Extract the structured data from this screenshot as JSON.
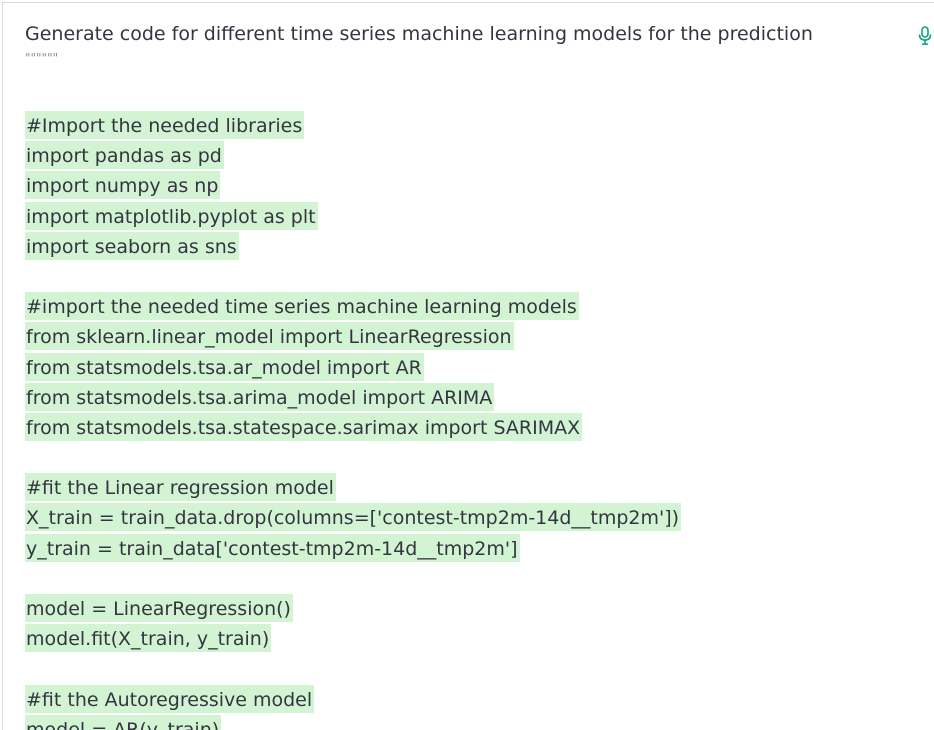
{
  "prompt": {
    "text": "Generate code for different time series machine learning models for the prediction",
    "quotes": "\"\"\"\"\"\""
  },
  "icons": {
    "mic": "microphone-icon",
    "accent": "#10a37f"
  },
  "colors": {
    "highlight": "#d2f4d3",
    "text": "#343541"
  },
  "code_lines": [
    "#Import the needed libraries",
    "import pandas as pd",
    "import numpy as np",
    "import matplotlib.pyplot as plt",
    "import seaborn as sns",
    "",
    "#import the needed time series machine learning models",
    "from sklearn.linear_model import LinearRegression",
    "from statsmodels.tsa.ar_model import AR",
    "from statsmodels.tsa.arima_model import ARIMA",
    "from statsmodels.tsa.statespace.sarimax import SARIMAX",
    "",
    "#fit the Linear regression model",
    "X_train = train_data.drop(columns=['contest-tmp2m-14d__tmp2m'])",
    "y_train = train_data['contest-tmp2m-14d__tmp2m']",
    "",
    "model = LinearRegression()",
    "model.fit(X_train, y_train)",
    "",
    "#fit the Autoregressive model",
    "model = AR(y_train)"
  ]
}
